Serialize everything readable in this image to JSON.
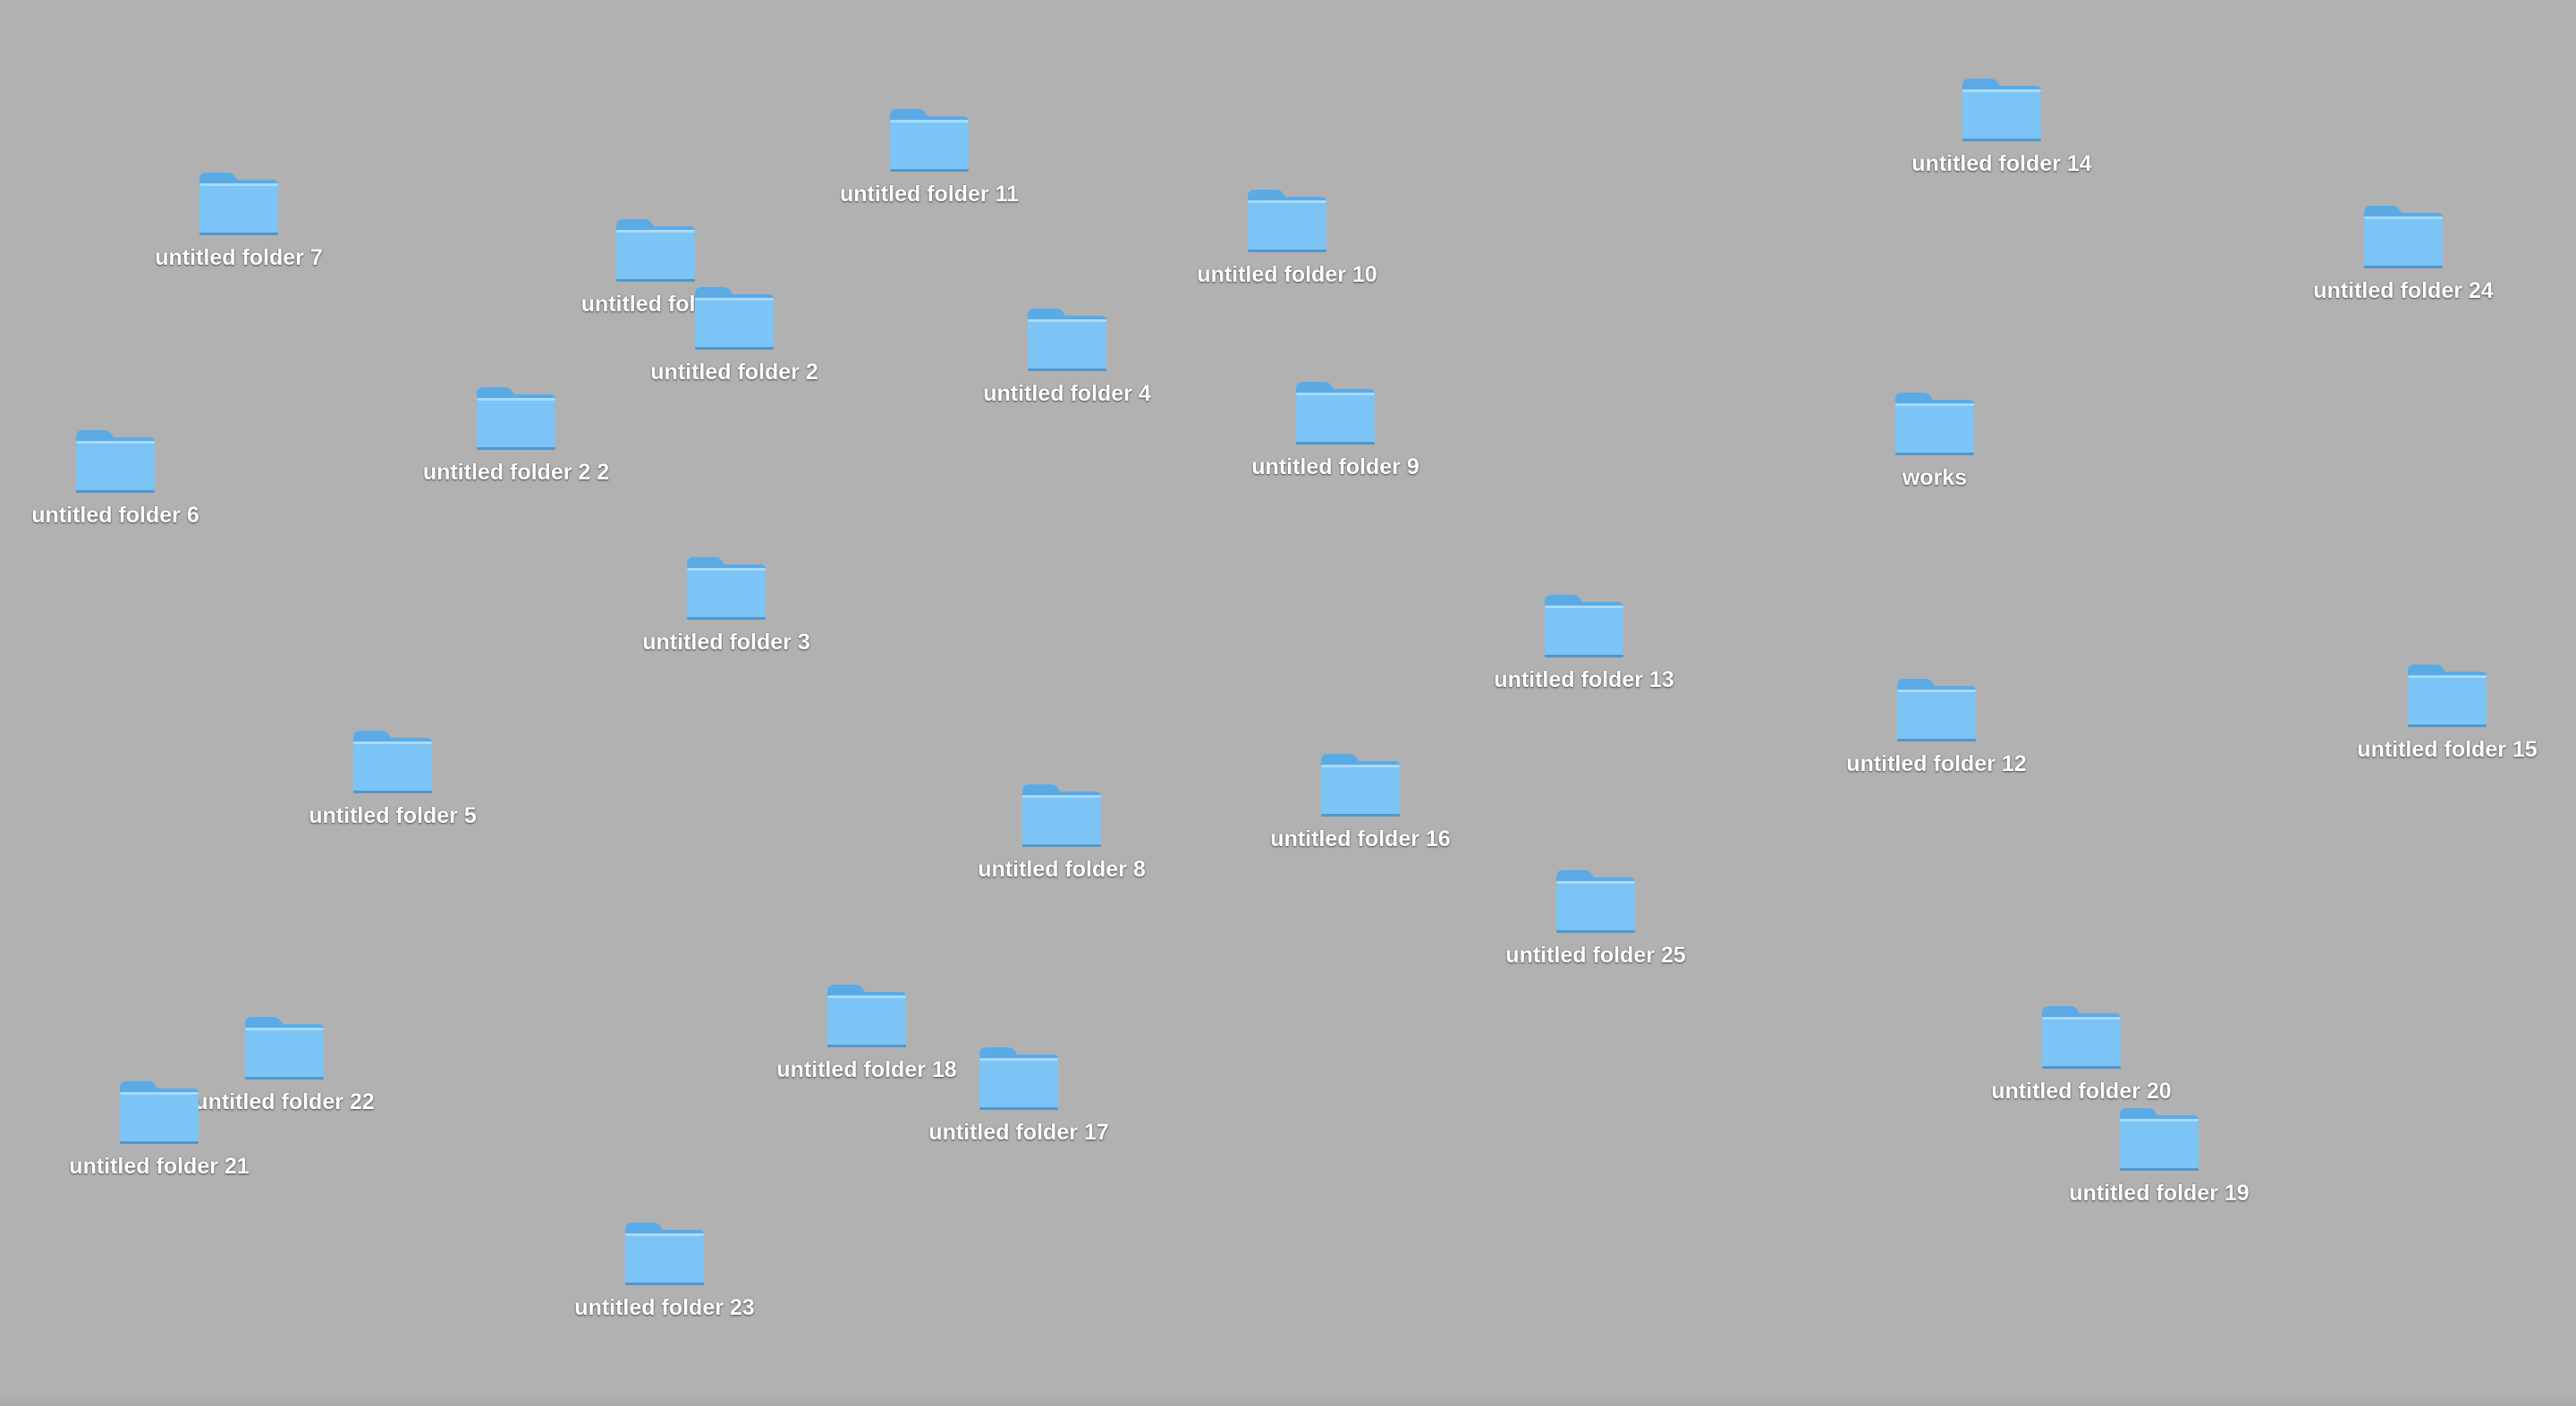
{
  "desktop": {
    "background_color": "#b1b1b1",
    "folder_color": "#7cc4f5",
    "folder_tab_color": "#5aaae6",
    "label_color": "#ffffff",
    "items": [
      {
        "label": "untitled folder 11",
        "icon": "folder-icon"
      },
      {
        "label": "untitled folder 14",
        "icon": "folder-icon"
      },
      {
        "label": "untitled folder 7",
        "icon": "folder-icon"
      },
      {
        "label": "untitled folder",
        "icon": "folder-icon"
      },
      {
        "label": "untitled folder 10",
        "icon": "folder-icon"
      },
      {
        "label": "untitled folder 24",
        "icon": "folder-icon"
      },
      {
        "label": "untitled folder 2",
        "icon": "folder-icon"
      },
      {
        "label": "untitled folder 4",
        "icon": "folder-icon"
      },
      {
        "label": "untitled folder 2 2",
        "icon": "folder-icon"
      },
      {
        "label": "untitled folder 9",
        "icon": "folder-icon"
      },
      {
        "label": "works",
        "icon": "folder-icon"
      },
      {
        "label": "untitled folder 6",
        "icon": "folder-icon"
      },
      {
        "label": "untitled folder 3",
        "icon": "folder-icon"
      },
      {
        "label": "untitled folder 13",
        "icon": "folder-icon"
      },
      {
        "label": "untitled folder 12",
        "icon": "folder-icon"
      },
      {
        "label": "untitled folder 15",
        "icon": "folder-icon"
      },
      {
        "label": "untitled folder 5",
        "icon": "folder-icon"
      },
      {
        "label": "untitled folder 16",
        "icon": "folder-icon"
      },
      {
        "label": "untitled folder 8",
        "icon": "folder-icon"
      },
      {
        "label": "untitled folder 25",
        "icon": "folder-icon"
      },
      {
        "label": "untitled folder 22",
        "icon": "folder-icon"
      },
      {
        "label": "untitled folder 18",
        "icon": "folder-icon"
      },
      {
        "label": "untitled folder 17",
        "icon": "folder-icon"
      },
      {
        "label": "untitled folder 21",
        "icon": "folder-icon"
      },
      {
        "label": "untitled folder 20",
        "icon": "folder-icon"
      },
      {
        "label": "untitled folder 19",
        "icon": "folder-icon"
      },
      {
        "label": "untitled folder 23",
        "icon": "folder-icon"
      }
    ]
  }
}
